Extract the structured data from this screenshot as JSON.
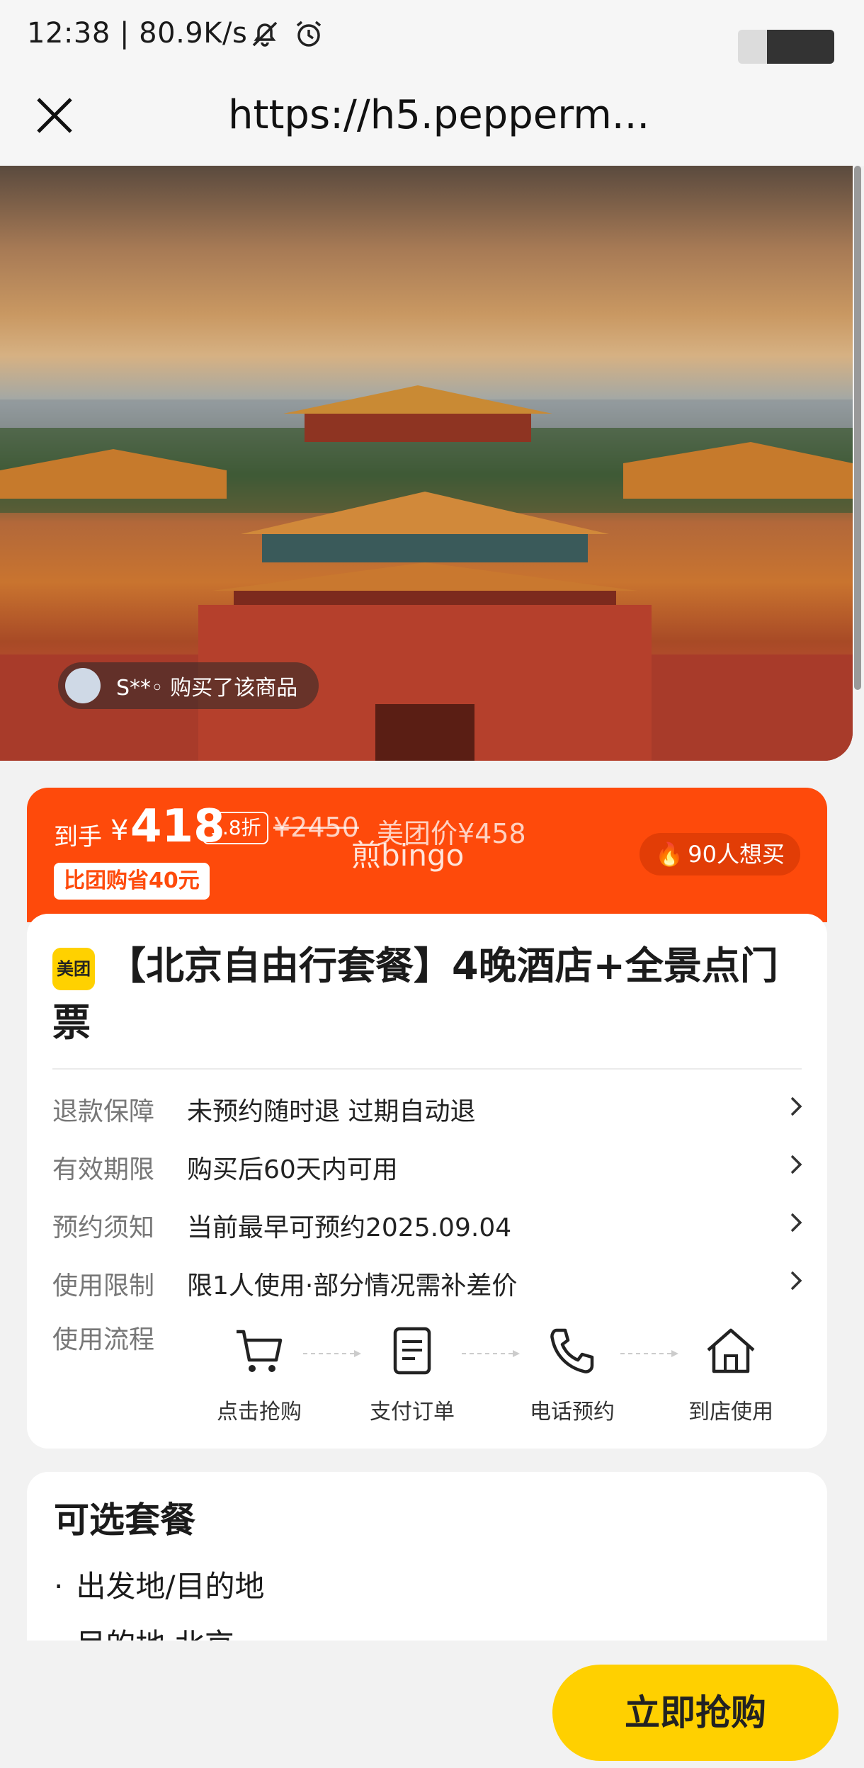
{
  "status_bar": {
    "text": "12:38 | 80.9K/s"
  },
  "url_bar": {
    "url": "https://h5.pepperm..."
  },
  "hero": {
    "buyer_text": "S**◦ 购买了该商品"
  },
  "price_banner": {
    "label": "到手",
    "currency": "¥",
    "price": "418",
    "discount": "1.8折",
    "original_price": "¥2450",
    "meituan_price": "美团价¥458",
    "watermark": "煎bingo",
    "save_badge": "比团购省40元",
    "want_count": "90人想买"
  },
  "product": {
    "brand": "美团",
    "title": "【北京自由行套餐】4晚酒店+全景点门票"
  },
  "details": [
    {
      "label": "退款保障",
      "value": "未预约随时退 过期自动退"
    },
    {
      "label": "有效期限",
      "value": "购买后60天内可用"
    },
    {
      "label": "预约须知",
      "value": "当前最早可预约2025.09.04"
    },
    {
      "label": "使用限制",
      "value": "限1人使用·部分情况需补差价"
    }
  ],
  "flow": {
    "label": "使用流程",
    "steps": [
      {
        "label": "点击抢购",
        "icon": "cart-icon"
      },
      {
        "label": "支付订单",
        "icon": "document-icon"
      },
      {
        "label": "电话预约",
        "icon": "phone-icon"
      },
      {
        "label": "到店使用",
        "icon": "home-icon"
      }
    ]
  },
  "package": {
    "title": "可选套餐",
    "items": [
      "出发地/目的地",
      "目的地 北京"
    ]
  },
  "bottom": {
    "buy_label": "立即抢购"
  },
  "colors": {
    "accent": "#fe4a0b",
    "button": "#ffd000"
  }
}
